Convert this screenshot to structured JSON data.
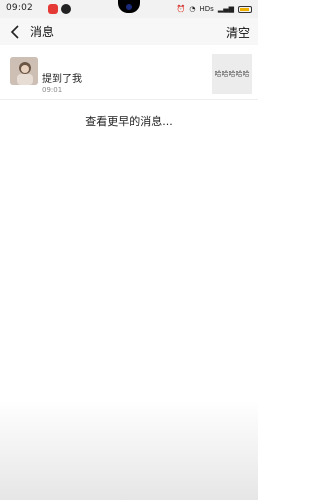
{
  "status_bar": {
    "time": "09:02",
    "right_text": "HDs"
  },
  "header": {
    "title": "消息",
    "clear_label": "清空"
  },
  "messages": [
    {
      "user": "",
      "text": "提到了我",
      "time": "09:01",
      "thumb_text": "哈哈哈哈哈"
    }
  ],
  "load_more": "查看更早的消息..."
}
